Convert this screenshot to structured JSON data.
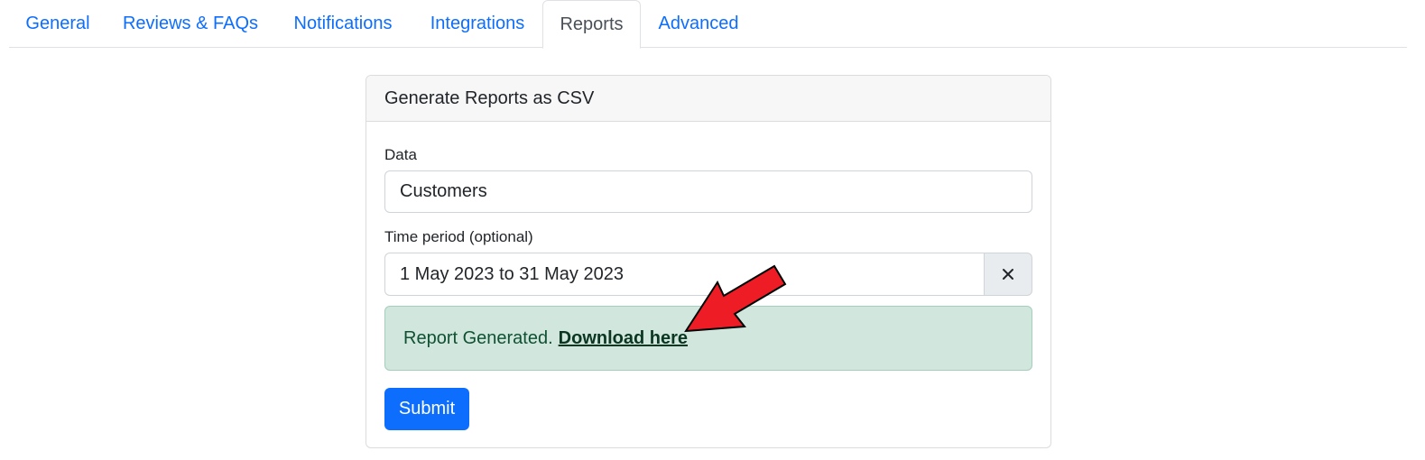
{
  "tabs": [
    {
      "label": "General",
      "active": false
    },
    {
      "label": "Reviews & FAQs",
      "active": false
    },
    {
      "label": "Notifications",
      "active": false
    },
    {
      "label": "Integrations",
      "active": false
    },
    {
      "label": "Reports",
      "active": true
    },
    {
      "label": "Advanced",
      "active": false
    }
  ],
  "card": {
    "title": "Generate Reports as CSV",
    "data_label": "Data",
    "data_value": "Customers",
    "period_label": "Time period (optional)",
    "period_value": "1 May 2023 to 31 May 2023",
    "clear_icon": "close-icon",
    "alert_text": "Report Generated.",
    "alert_link": "Download here",
    "submit_label": "Submit"
  },
  "colors": {
    "link": "#0d6efd",
    "alert_bg": "#d1e7dd",
    "alert_text": "#0f5132",
    "primary": "#0d6efd",
    "annotation_arrow": "#ee1c25"
  }
}
